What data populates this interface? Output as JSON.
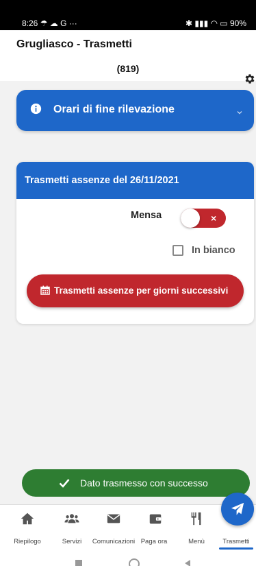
{
  "status_bar": {
    "left": "8:26 ☂ ☁ G  ···",
    "right": "✱  ▮▮▮  ◠  ▭ 90%"
  },
  "header": {
    "title": "Grugliasco - Trasmetti",
    "subtitle": "(819)",
    "settings_icon": "gear-icon"
  },
  "info_panel": {
    "label": "Orari di fine rilevazione",
    "icon": "info-icon"
  },
  "card": {
    "title": "Trasmetti assenze del 26/11/2021",
    "mensa_label": "Mensa",
    "toggle_mark": "×",
    "checkbox_label": "In bianco",
    "action_label": "Trasmetti assenze per giorni successivi"
  },
  "toast": {
    "message": "Dato trasmesso con successo"
  },
  "nav": {
    "items": [
      {
        "label": "Riepilogo",
        "icon": "home-icon"
      },
      {
        "label": "Servizi",
        "icon": "users-icon"
      },
      {
        "label": "Comunicazioni",
        "icon": "mail-icon"
      },
      {
        "label": "Paga ora",
        "icon": "wallet-icon"
      },
      {
        "label": "Menù",
        "icon": "utensils-icon"
      },
      {
        "label": "Trasmetti",
        "icon": "send-icon"
      }
    ],
    "active": "Trasmetti"
  },
  "colors": {
    "primary": "#1e67c9",
    "danger": "#c0272d",
    "success": "#2e7d32"
  }
}
